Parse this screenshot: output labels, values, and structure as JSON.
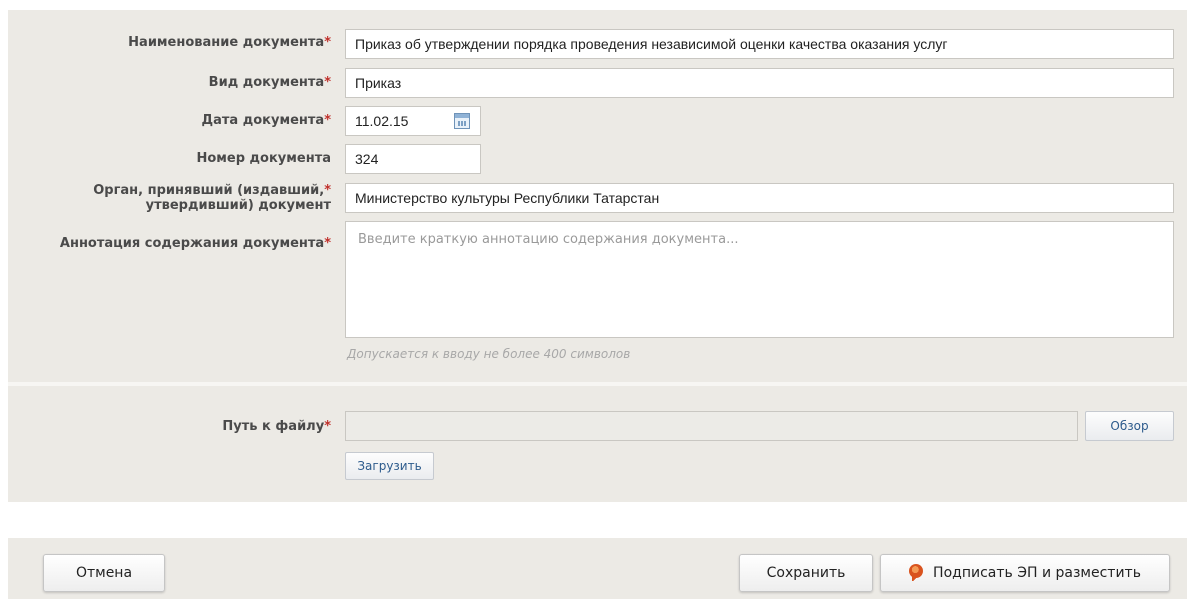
{
  "form": {
    "doc_name": {
      "label": "Наименование документа",
      "required": "*",
      "value": "Приказ об утверждении порядка проведения независимой оценки качества оказания услуг"
    },
    "doc_type": {
      "label": "Вид документа",
      "required": "*",
      "value": "Приказ"
    },
    "doc_date": {
      "label": "Дата документа",
      "required": "*",
      "value": "11.02.15",
      "icon": "calendar-icon"
    },
    "doc_number": {
      "label": "Номер документа",
      "value": "324"
    },
    "doc_authority": {
      "label_line1": "Орган, принявший (издавший,",
      "label_line2": "утвердивший) документ",
      "required": "*",
      "value": "Министерство культуры Республики Татарстан"
    },
    "doc_annotation": {
      "label": "Аннотация содержания документа",
      "required": "*",
      "placeholder": "Введите краткую аннотацию содержания документа...",
      "hint": "Допускается к вводу не более 400 символов"
    }
  },
  "upload": {
    "file_path": {
      "label": "Путь к файлу",
      "required": "*",
      "value": ""
    },
    "browse_label": "Обзор",
    "upload_label": "Загрузить"
  },
  "footer": {
    "cancel_label": "Отмена",
    "save_label": "Сохранить",
    "sign_label": "Подписать ЭП и разместить",
    "sign_icon": "seal-icon"
  },
  "colors": {
    "panel_bg": "#eceae5",
    "required": "#c0302b",
    "link_blue": "#2d5b8c"
  }
}
